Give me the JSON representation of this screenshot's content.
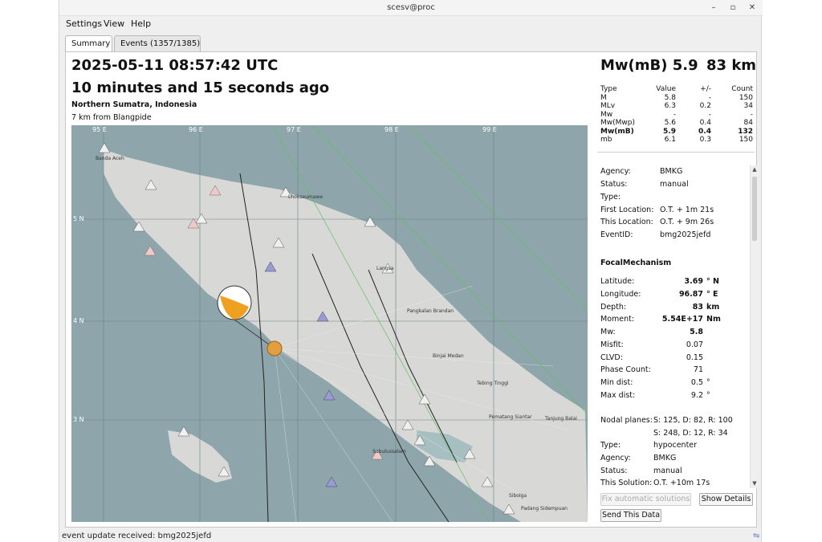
{
  "window": {
    "title": "scesv@proc",
    "minimize": "–",
    "restore": "▫",
    "close": "✕"
  },
  "menu": {
    "settings": "Settings",
    "view": "View",
    "help": "Help"
  },
  "tabs": {
    "summary": "Summary",
    "events": "Events (1357/1385)"
  },
  "event": {
    "origin_time": "2025-05-11 08:57:42 UTC",
    "time_ago": "10 minutes and 15 seconds ago",
    "region": "Northern Sumatra, Indonesia",
    "nearest_city": "7 km from Blangpide",
    "magnitude_label": "Mw(mB)  5.9",
    "depth_label": "83 km"
  },
  "magnitudes": {
    "headers": [
      "Type",
      "Value",
      "+/-",
      "Count"
    ],
    "rows": [
      [
        "M",
        "5.8",
        "-",
        "150"
      ],
      [
        "MLv",
        "6.3",
        "0.2",
        "34"
      ],
      [
        "Mw",
        "-",
        "-",
        "-"
      ],
      [
        "Mw(Mwp)",
        "5.6",
        "0.4",
        "84"
      ],
      [
        "Mw(mB)",
        "5.9",
        "0.4",
        "132"
      ],
      [
        "mb",
        "6.1",
        "0.3",
        "150"
      ]
    ]
  },
  "details": {
    "agency_label": "Agency:",
    "agency": "BMKG",
    "status_label": "Status:",
    "status": "manual",
    "type_label": "Type:",
    "type": "",
    "first_loc_label": "First Location:",
    "first_loc": "O.T. + 1m 21s",
    "this_loc_label": "This Location:",
    "this_loc": "O.T. + 9m 26s",
    "eventid_label": "EventID:",
    "eventid": "bmg2025jefd"
  },
  "focal": {
    "title": "FocalMechanism",
    "latitude_label": "Latitude:",
    "latitude": "3.69",
    "latitude_unit": "° N",
    "longitude_label": "Longitude:",
    "longitude": "96.87",
    "longitude_unit": "° E",
    "depth_label": "Depth:",
    "depth": "83",
    "depth_unit": "km",
    "moment_label": "Moment:",
    "moment": "5.54E+17",
    "moment_unit": "Nm",
    "mw_label": "Mw:",
    "mw": "5.8",
    "misfit_label": "Misfit:",
    "misfit": "0.07",
    "clvd_label": "CLVD:",
    "clvd": "0.15",
    "phase_count_label": "Phase Count:",
    "phase_count": "71",
    "min_dist_label": "Min dist:",
    "min_dist": "0.5",
    "min_dist_unit": "°",
    "max_dist_label": "Max dist:",
    "max_dist": "9.2",
    "max_dist_unit": "°",
    "nodal_label": "Nodal planes:",
    "nodal1": "S: 125, D: 82, R: 100",
    "nodal2": "S: 248, D: 12, R: 34",
    "type_label": "Type:",
    "type": "hypocenter",
    "agency_label": "Agency:",
    "agency": "BMKG",
    "status_label": "Status:",
    "status": "manual",
    "solution_label": "This Solution:",
    "solution": "O.T. +10m 17s"
  },
  "buttons": {
    "fix": "Fix automatic solutions",
    "show_details": "Show Details",
    "send": "Send This Data"
  },
  "map": {
    "lon_labels": [
      "95 E",
      "96 E",
      "97 E",
      "98 E",
      "99 E"
    ],
    "lat_labels": [
      "5 N",
      "4 N",
      "3 N"
    ],
    "places": [
      "Banda Aceh",
      "Lhokseumawe",
      "Langsa",
      "Pangkalan Brandan",
      "Binjai Medan",
      "Tebing Tinggi",
      "Pematang Siantar",
      "Tanjung Balai",
      "Subulussalam",
      "Sibolga",
      "Padang Sidempuan"
    ],
    "colors": {
      "sea": "#8ea6ab",
      "land": "#d9d9d7",
      "mechanism": "#f0a020",
      "epicenter": "#e0a040"
    }
  },
  "status": {
    "message": "event update received: bmg2025jefd"
  }
}
